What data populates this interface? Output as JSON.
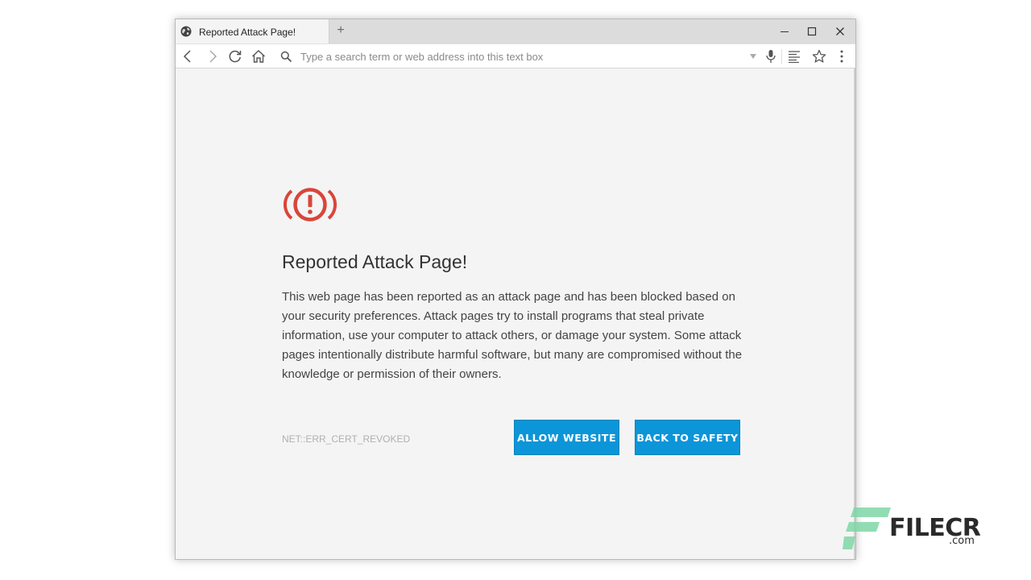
{
  "browser": {
    "tab": {
      "title": "Reported Attack Page!"
    },
    "new_tab_label": "+",
    "address_bar": {
      "placeholder": "Type a search term or web address into this text box"
    },
    "icons": [
      "globe-icon",
      "back-icon",
      "forward-icon",
      "reload-icon",
      "home-icon",
      "search-icon",
      "dropdown-icon",
      "microphone-icon",
      "reader-icon",
      "star-icon",
      "menu-icon",
      "minimize-icon",
      "maximize-icon",
      "close-icon"
    ]
  },
  "page": {
    "heading": "Reported Attack Page!",
    "description": "This web page has been reported as an attack page and has been blocked based on your security preferences. Attack pages try to install programs that steal private information, use your computer to attack others, or damage your system. Some attack pages intentionally distribute harmful software, but many are compromised without the knowledge or permission of their owners.",
    "error_code": "NET::ERR_CERT_REVOKED",
    "buttons": {
      "allow": "ALLOW WEBSITE",
      "back": "BACK TO SAFETY"
    },
    "icon": "warning-alert-icon"
  },
  "watermark": {
    "brand": "FILECR",
    "domain": ".com"
  },
  "colors": {
    "accent": "#0c95d8",
    "warning": "#d9453a",
    "background": "#f4f4f4"
  }
}
